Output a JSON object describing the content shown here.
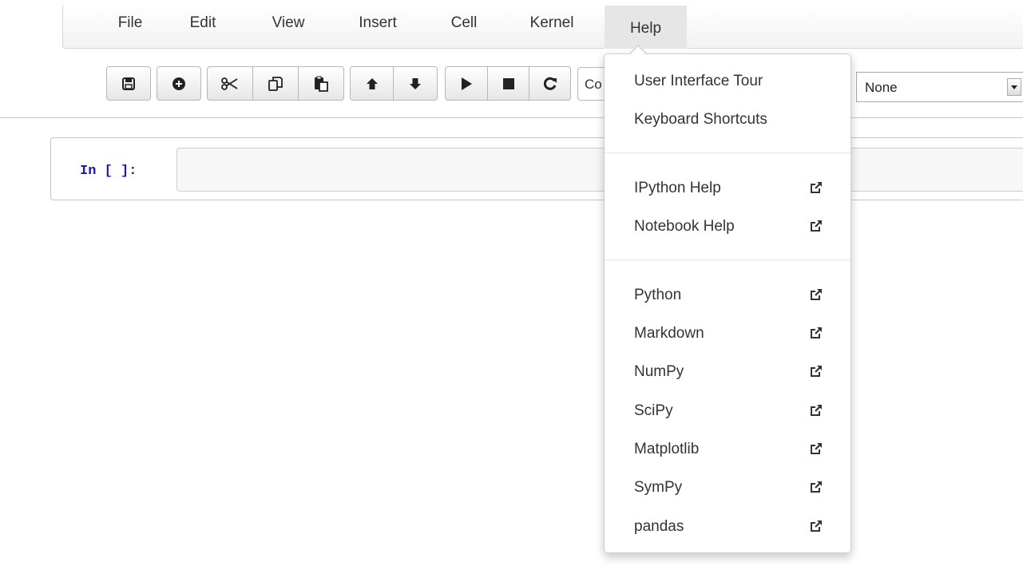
{
  "menubar": {
    "items": [
      {
        "label": "File"
      },
      {
        "label": "Edit"
      },
      {
        "label": "View"
      },
      {
        "label": "Insert"
      },
      {
        "label": "Cell"
      },
      {
        "label": "Kernel"
      },
      {
        "label": "Help",
        "active": true
      }
    ]
  },
  "toolbar": {
    "buttons": [
      {
        "icon": "save-icon"
      },
      {
        "icon": "plus-circle-icon"
      },
      {
        "icon": "scissors-icon"
      },
      {
        "icon": "copy-icon"
      },
      {
        "icon": "paste-icon"
      },
      {
        "icon": "arrow-up-icon"
      },
      {
        "icon": "arrow-down-icon"
      },
      {
        "icon": "play-icon"
      },
      {
        "icon": "stop-icon"
      },
      {
        "icon": "restart-icon"
      }
    ],
    "cell_type_partial": "Co",
    "cell_toolbar_select": "None"
  },
  "cell": {
    "prompt": "In [ ]:",
    "input_value": ""
  },
  "help_menu": {
    "items": [
      {
        "label": "User Interface Tour",
        "external": false
      },
      {
        "label": "Keyboard Shortcuts",
        "external": false
      },
      {
        "label": "IPython Help",
        "external": true
      },
      {
        "label": "Notebook Help",
        "external": true
      },
      {
        "label": "Python",
        "external": true
      },
      {
        "label": "Markdown",
        "external": true
      },
      {
        "label": "NumPy",
        "external": true
      },
      {
        "label": "SciPy",
        "external": true
      },
      {
        "label": "Matplotlib",
        "external": true
      },
      {
        "label": "SymPy",
        "external": true
      },
      {
        "label": "pandas",
        "external": true
      }
    ]
  },
  "colors": {
    "prompt_blue": "#1a1aa6",
    "active_menu_bg": "#e6e6e6"
  }
}
